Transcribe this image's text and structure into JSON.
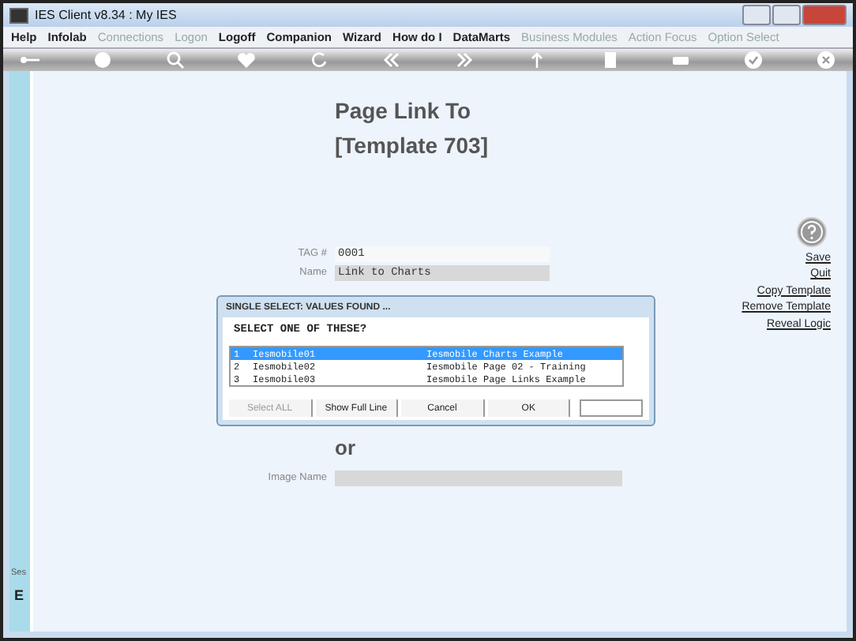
{
  "window": {
    "title": "IES Client v8.34 : My IES"
  },
  "menu": [
    {
      "label": "Help",
      "disabled": false
    },
    {
      "label": "Infolab",
      "disabled": false
    },
    {
      "label": "Connections",
      "disabled": true
    },
    {
      "label": "Logon",
      "disabled": true
    },
    {
      "label": "Logoff",
      "disabled": false
    },
    {
      "label": "Companion",
      "disabled": false
    },
    {
      "label": "Wizard",
      "disabled": false
    },
    {
      "label": "How do I",
      "disabled": false
    },
    {
      "label": "DataMarts",
      "disabled": false
    },
    {
      "label": "Business Modules",
      "disabled": true
    },
    {
      "label": "Action Focus",
      "disabled": true
    },
    {
      "label": "Option Select",
      "disabled": true
    }
  ],
  "page": {
    "heading": "Page Link To",
    "subheading": "[Template 703]",
    "tag_label": "TAG #",
    "tag_value": "0001",
    "name_label": "Name",
    "name_value": "Link to Charts",
    "or_text": "or",
    "image_label": "Image Name"
  },
  "actions": [
    "Save",
    "Quit",
    "Copy Template",
    "Remove Template",
    "Reveal Logic"
  ],
  "sidebar": {
    "label": "Ses",
    "letter": "E"
  },
  "dialog": {
    "title": "SINGLE SELECT: VALUES FOUND ...",
    "prompt": "SELECT ONE OF THESE?",
    "rows": [
      {
        "number": "1",
        "code": "Iesmobile01",
        "description": "Iesmobile Charts Example",
        "selected": true
      },
      {
        "number": "2",
        "code": "Iesmobile02",
        "description": "Iesmobile Page 02 - Training",
        "selected": false
      },
      {
        "number": "3",
        "code": "Iesmobile03",
        "description": "Iesmobile Page Links Example",
        "selected": false
      }
    ],
    "buttons": [
      {
        "label": "Select ALL",
        "disabled": true
      },
      {
        "label": "Show Full Line",
        "disabled": false
      },
      {
        "label": "Cancel",
        "disabled": false
      },
      {
        "label": "OK",
        "disabled": false
      }
    ]
  }
}
